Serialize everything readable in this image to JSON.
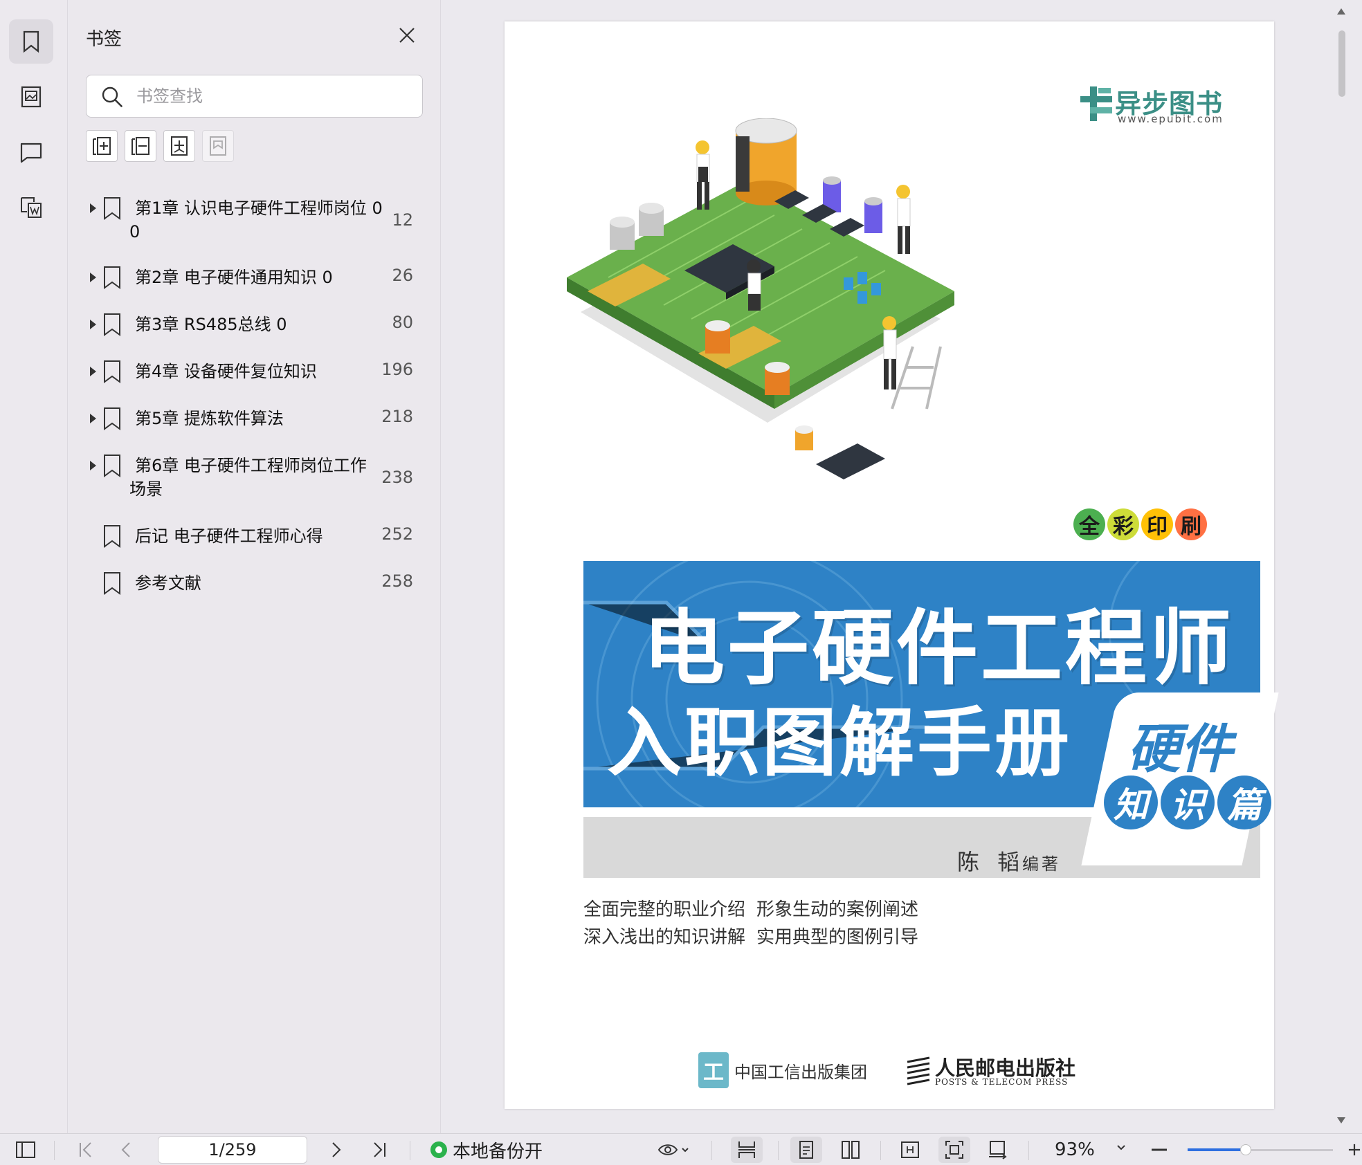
{
  "sidebar_rail": {
    "items": [
      {
        "icon": "bookmark-icon",
        "active": true
      },
      {
        "icon": "thumbnail-icon",
        "active": false
      },
      {
        "icon": "comment-icon",
        "active": false
      },
      {
        "icon": "convert-word-icon",
        "active": false
      }
    ]
  },
  "bookmarks_panel": {
    "title": "书签",
    "search_placeholder": "书签查找",
    "tools": [
      "add-bookmark-icon",
      "collapse-all-icon",
      "add-sub-bookmark-icon",
      "delete-bookmark-icon"
    ],
    "items": [
      {
        "line1": "第1章 认识电子硬件工程师岗位 0",
        "line2": "0",
        "page": "12",
        "expandable": true
      },
      {
        "line1": "第2章 电子硬件通用知识 0",
        "line2": "",
        "page": "26",
        "expandable": true
      },
      {
        "line1": "第3章 RS485总线 0",
        "line2": "",
        "page": "80",
        "expandable": true
      },
      {
        "line1": "第4章 设备硬件复位知识",
        "line2": "",
        "page": "196",
        "expandable": true
      },
      {
        "line1": "第5章 提炼软件算法",
        "line2": "",
        "page": "218",
        "expandable": true
      },
      {
        "line1": "第6章 电子硬件工程师岗位工作",
        "line2": "场景",
        "page": "238",
        "expandable": true
      },
      {
        "line1": "后记 电子硬件工程师心得",
        "line2": "",
        "page": "252",
        "expandable": false
      },
      {
        "line1": "参考文献",
        "line2": "",
        "page": "258",
        "expandable": false
      }
    ]
  },
  "cover": {
    "publisher_logo_name": "异步图书",
    "publisher_logo_url": "www.epubit.com",
    "full_color_chars": [
      "全",
      "彩",
      "印",
      "刷"
    ],
    "full_color_colors": [
      "#4caf50",
      "#cddc39",
      "#ffc107",
      "#ff7043"
    ],
    "title_line1": "电子硬件工程师",
    "title_line2": "入职图解手册",
    "subtitle_top": "硬件",
    "subtitle_chars": [
      "知",
      "识",
      "篇"
    ],
    "author": "陈 韬",
    "author_role": "编著",
    "features": [
      [
        "全面完整的职业介绍",
        "形象生动的案例阐述"
      ],
      [
        "深入浅出的知识讲解",
        "实用典型的图例引导"
      ]
    ],
    "publisher1": "中国工信出版集团",
    "publisher2": "人民邮电出版社",
    "publisher2_en": "POSTS & TELECOM PRESS",
    "accent_blue": "#2e82c6"
  },
  "status_bar": {
    "page_indicator": "1/259",
    "backup_label": "本地备份开",
    "zoom": "93%",
    "zoom_level": 0.4
  }
}
